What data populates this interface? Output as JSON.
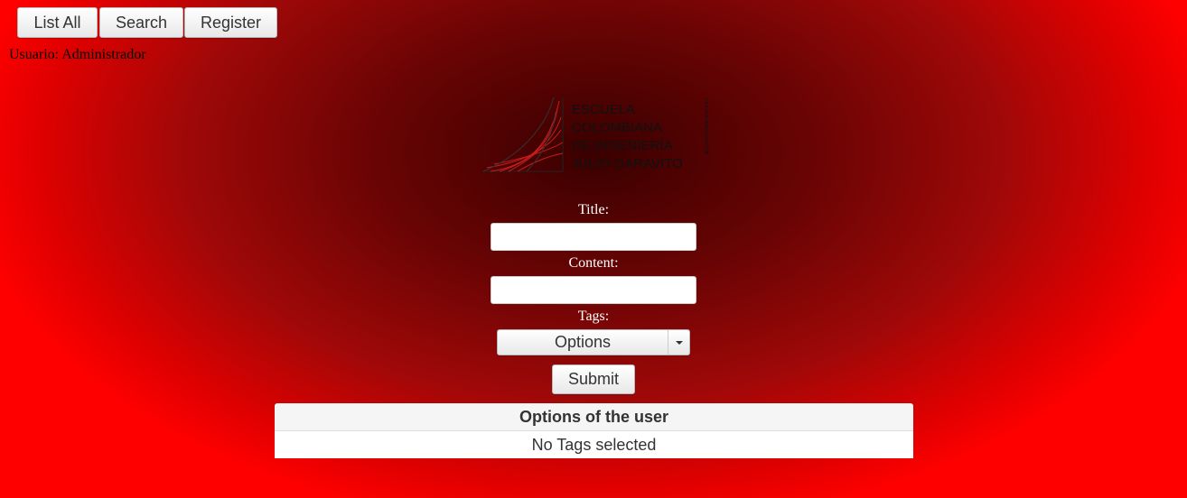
{
  "nav": {
    "list_all": "List All",
    "search": "Search",
    "register": "Register"
  },
  "user": {
    "label": "Usuario: Administrador"
  },
  "logo": {
    "line1": "ESCUELA",
    "line2": "COLOMBIANA",
    "line3": "DE INGENIERÍA",
    "line4": "JULIO GARAVITO",
    "side_text": "VIGILADA MINEDUCACIÓN",
    "accent_color": "#c41e1e"
  },
  "form": {
    "title_label": "Title:",
    "title_value": "",
    "content_label": "Content:",
    "content_value": "",
    "tags_label": "Tags:",
    "tags_select": "Options",
    "submit_label": "Submit"
  },
  "options_table": {
    "header": "Options of the user",
    "empty_text": "No Tags selected"
  }
}
